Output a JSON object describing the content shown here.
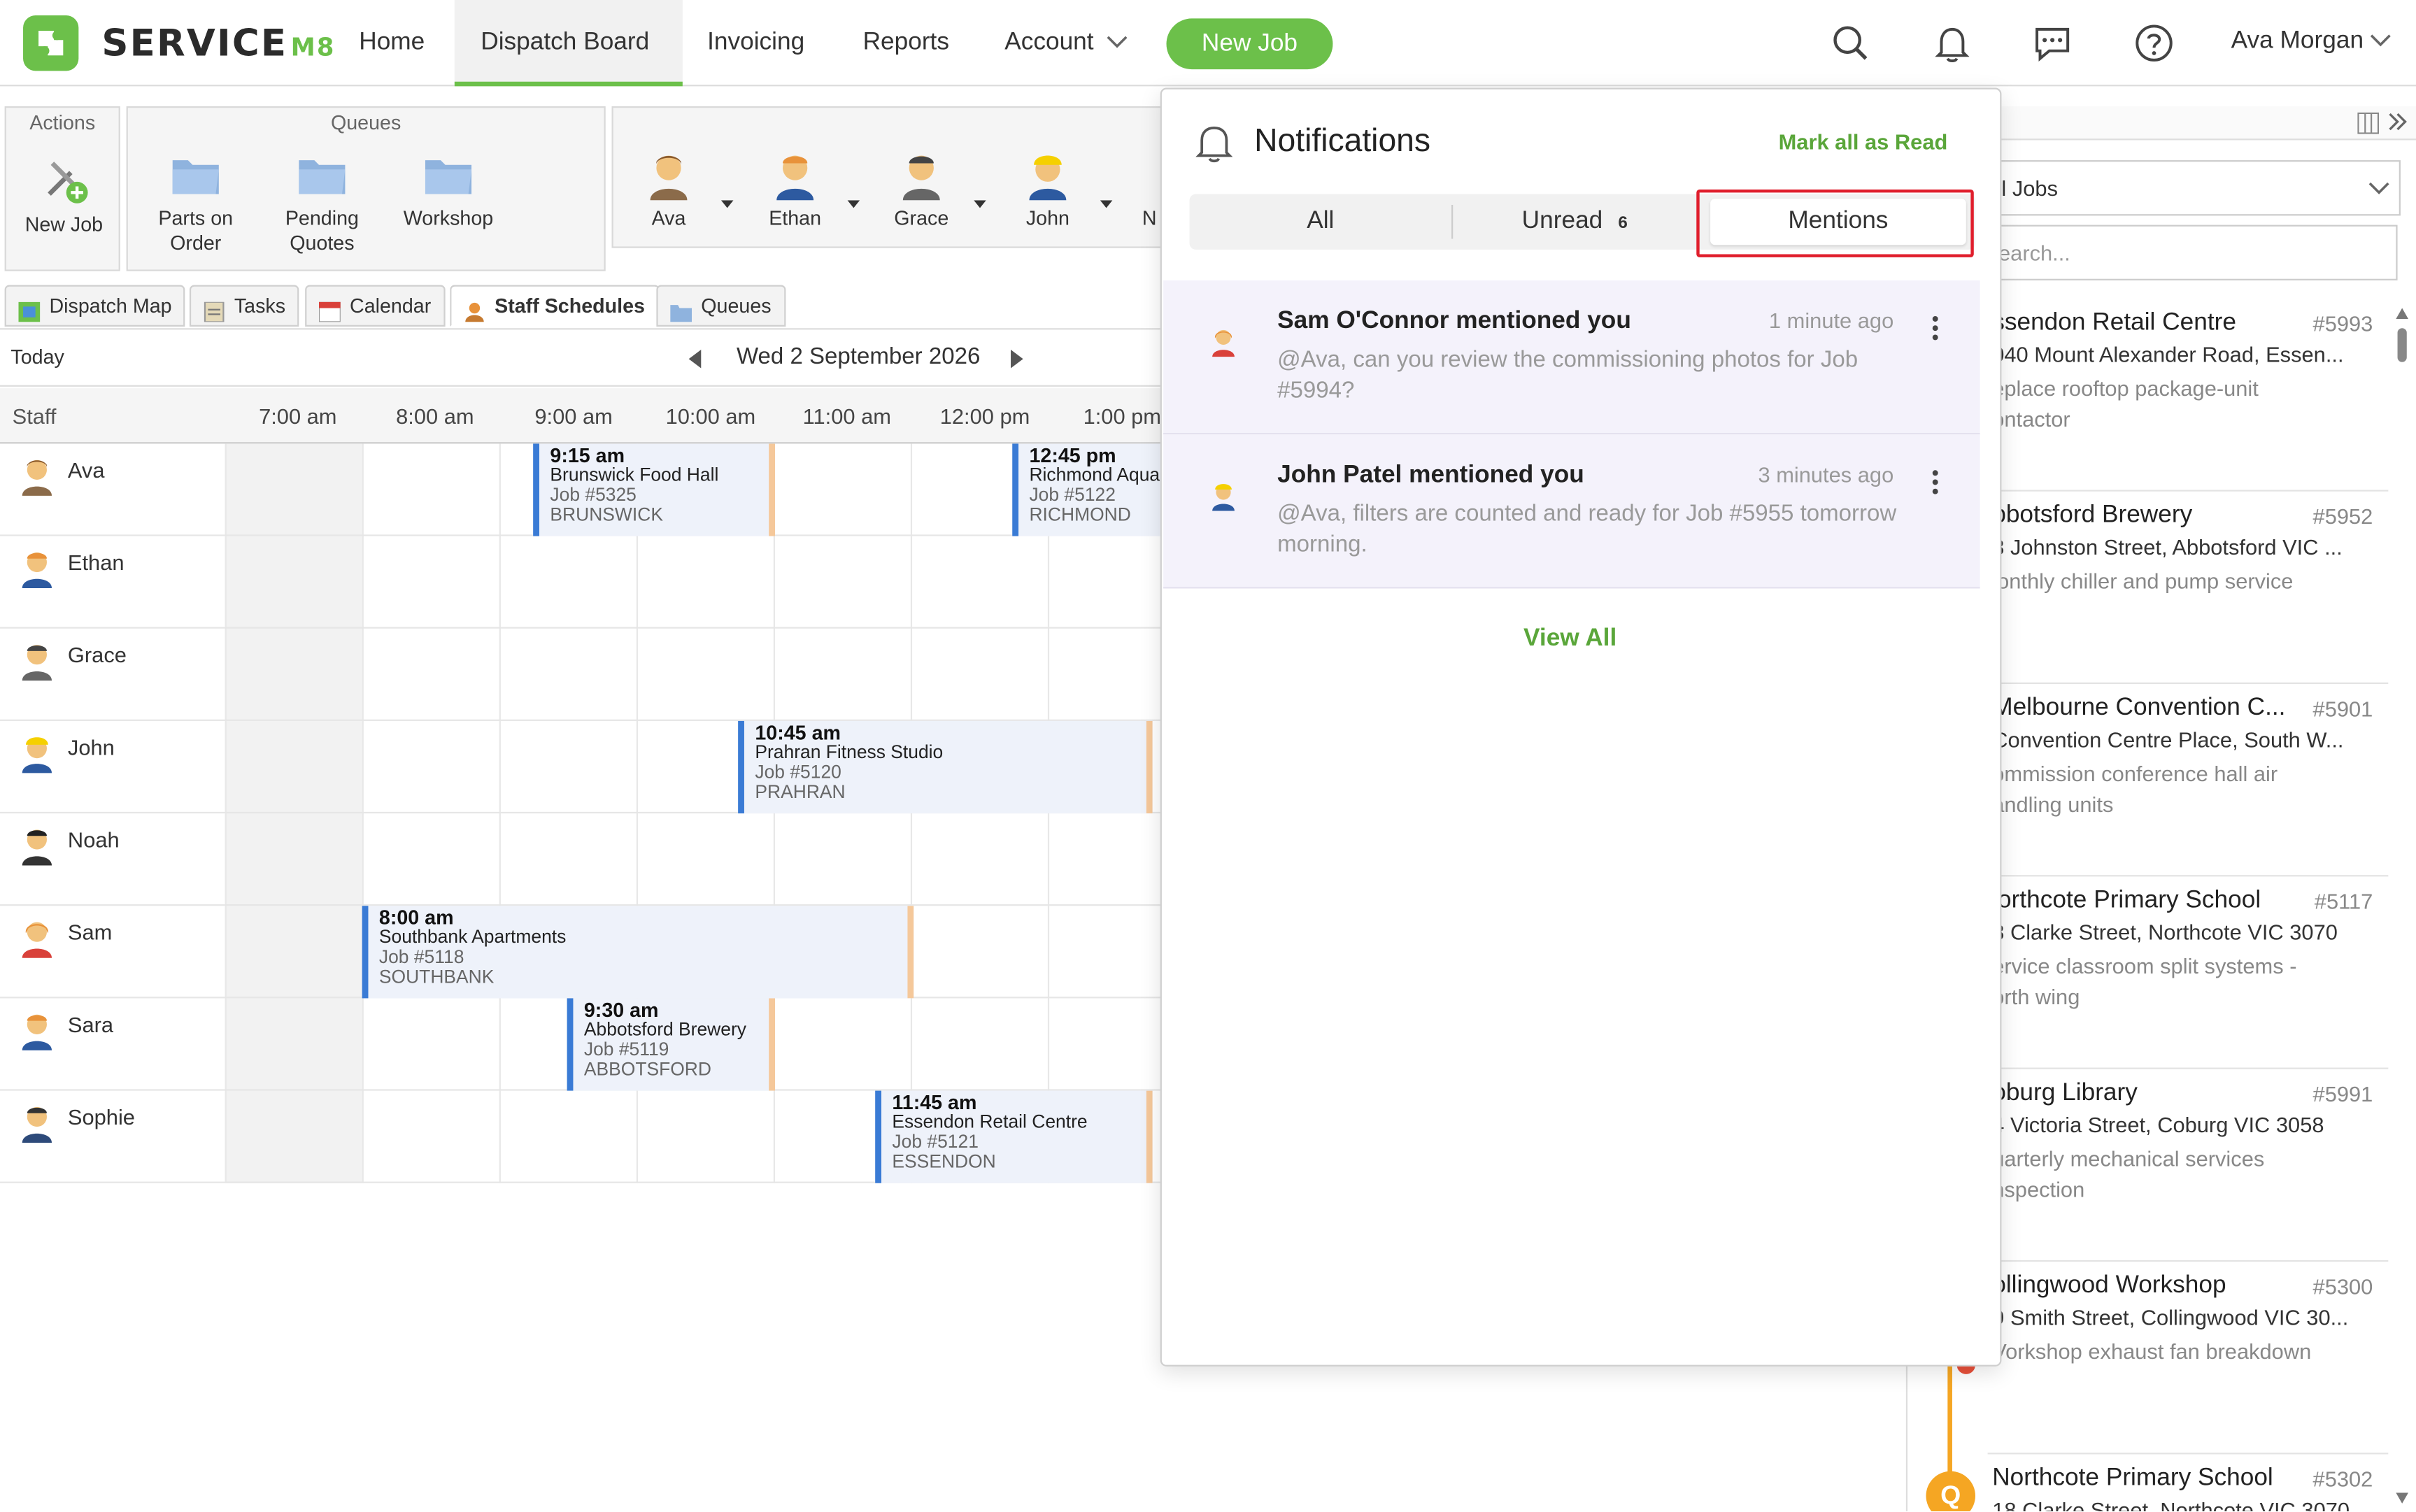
{
  "app": {
    "logo_text": "SERVICE",
    "logo_suffix": "M8"
  },
  "nav": {
    "items": [
      {
        "label": "Home"
      },
      {
        "label": "Dispatch Board"
      },
      {
        "label": "Invoicing"
      },
      {
        "label": "Reports"
      },
      {
        "label": "Account"
      }
    ],
    "new_job": "New Job",
    "user": "Ava Morgan"
  },
  "toolbar": {
    "actions_title": "Actions",
    "queues_title": "Queues",
    "new_job": "New Job",
    "parts_on_order": [
      "Parts on",
      "Order"
    ],
    "pending_quotes": [
      "Pending",
      "Quotes"
    ],
    "workshop": "Workshop",
    "staff": [
      "Ava",
      "Ethan",
      "Grace",
      "John",
      "N"
    ]
  },
  "tabs": [
    {
      "label": "Dispatch Map"
    },
    {
      "label": "Tasks"
    },
    {
      "label": "Calendar"
    },
    {
      "label": "Staff Schedules"
    },
    {
      "label": "Queues"
    }
  ],
  "datebar": {
    "today": "Today",
    "date": "Wed 2 September 2026"
  },
  "schedule": {
    "staff_header": "Staff",
    "times": [
      "7:00 am",
      "8:00 am",
      "9:00 am",
      "10:00 am",
      "11:00 am",
      "12:00 pm",
      "1:00 pm"
    ],
    "staff": [
      "Ava",
      "Ethan",
      "Grace",
      "John",
      "Noah",
      "Sam",
      "Sara",
      "Sophie"
    ],
    "jobs": [
      {
        "time": "9:15 am",
        "name": "Brunswick Food Hall",
        "job": "Job #5325",
        "suburb": "BRUNSWICK"
      },
      {
        "time": "12:45 pm",
        "name": "Richmond Aqua",
        "job": "Job #5122",
        "suburb": "RICHMOND"
      },
      {
        "time": "10:45 am",
        "name": "Prahran Fitness Studio",
        "job": "Job #5120",
        "suburb": "PRAHRAN"
      },
      {
        "time": "8:00 am",
        "name": "Southbank Apartments",
        "job": "Job #5118",
        "suburb": "SOUTHBANK"
      },
      {
        "time": "9:30 am",
        "name": "Abbotsford Brewery",
        "job": "Job #5119",
        "suburb": "ABBOTSFORD"
      },
      {
        "time": "11:45 am",
        "name": "Essendon Retail Centre",
        "job": "Job #5121",
        "suburb": "ESSENDON"
      }
    ]
  },
  "right_panel": {
    "filter": "l Jobs",
    "search_placeholder": "earch...",
    "cards": [
      {
        "name": "ssendon Retail Centre",
        "num": "#5993",
        "addr": "040 Mount Alexander Road, Essen...",
        "desc": "eplace rooftop package-unit ontactor"
      },
      {
        "name": "bbotsford Brewery",
        "num": "#5952",
        "addr": "8 Johnston Street, Abbotsford VIC ...",
        "desc": "lonthly chiller and pump service"
      },
      {
        "name": "Melbourne Convention C...",
        "num": "#5901",
        "addr": " Convention Centre Place, South W...",
        "desc": "ommission conference hall air andling units"
      },
      {
        "name": "lorthcote Primary School",
        "num": "#5117",
        "addr": "8 Clarke Street, Northcote VIC 3070",
        "desc": "ervice classroom split systems - orth wing"
      },
      {
        "name": "oburg Library",
        "num": "#5991",
        "addr": "4 Victoria Street, Coburg VIC 3058",
        "desc": "uarterly mechanical services nspection"
      },
      {
        "name": "ollingwood Workshop",
        "num": "#5300",
        "addr": "9 Smith Street, Collingwood VIC 30...",
        "desc": "Vorkshop exhaust fan breakdown"
      },
      {
        "name": "Northcote Primary School",
        "num": "#5302",
        "addr": "18 Clarke Street, Northcote VIC 3070",
        "desc": ""
      }
    ],
    "q_badge": "Q"
  },
  "notifications": {
    "title": "Notifications",
    "mark_all": "Mark all as Read",
    "tab_all": "All",
    "tab_unread": "Unread",
    "unread_count": "6",
    "tab_mentions": "Mentions",
    "items": [
      {
        "title": "Sam O'Connor mentioned you",
        "time": "1 minute ago",
        "body": "@Ava, can you review the commissioning photos for Job #5994?"
      },
      {
        "title": "John Patel mentioned you",
        "time": "3 minutes ago",
        "body": "@Ava, filters are counted and ready for Job #5955 tomorrow morning."
      }
    ],
    "view_all": "View All"
  },
  "colors": {
    "brand": "#6cc04a",
    "job_border": "#3a7bd5",
    "highlight": "#e01e2c"
  }
}
